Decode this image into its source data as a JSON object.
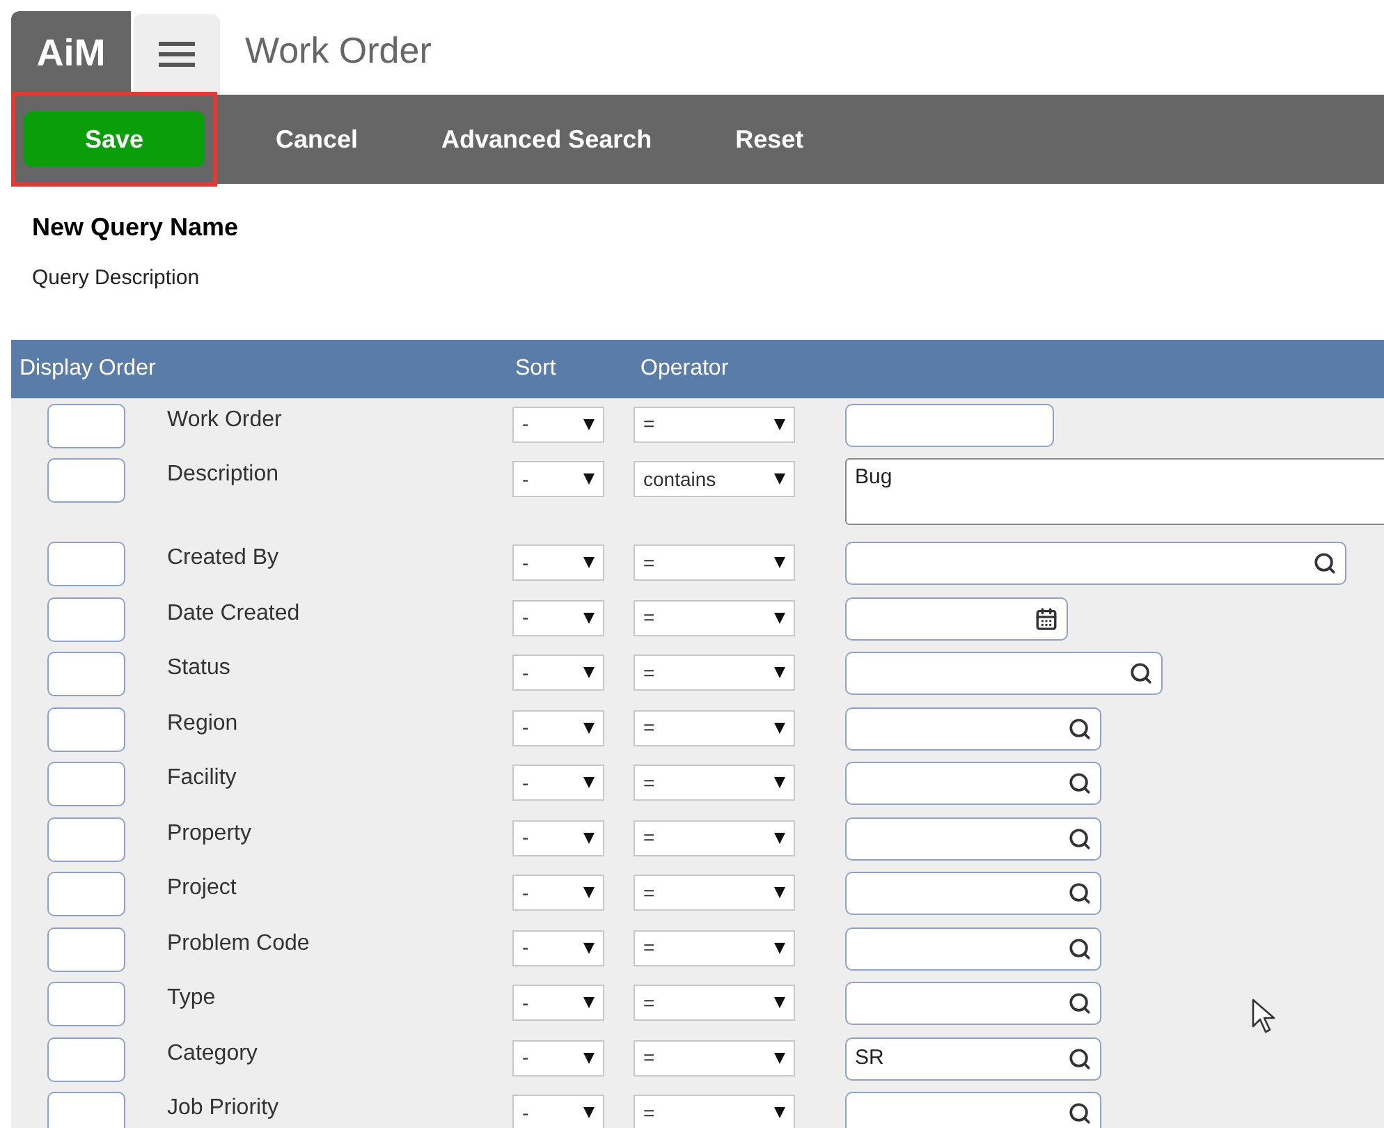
{
  "app": {
    "logo": "AiM",
    "title": "Work Order"
  },
  "toolbar": [
    {
      "label": "Save",
      "kind": "primary",
      "highlighted": true
    },
    {
      "label": "Cancel",
      "kind": "plain",
      "highlighted": false
    },
    {
      "label": "Advanced Search",
      "kind": "plain",
      "highlighted": false
    },
    {
      "label": "Reset",
      "kind": "plain",
      "highlighted": false
    }
  ],
  "query": {
    "name": "New Query Name",
    "description": "Query Description"
  },
  "table": {
    "columns": [
      "Display Order",
      "Sort",
      "Operator"
    ],
    "rows": [
      {
        "label": "Work Order",
        "sort": "-",
        "operator": "=",
        "kind": "text"
      },
      {
        "label": "Description",
        "sort": "-",
        "operator": "contains",
        "kind": "textarea",
        "value": "Bug"
      },
      {
        "label": "Created By",
        "sort": "-",
        "operator": "=",
        "kind": "lookup_wide"
      },
      {
        "label": "Date Created",
        "sort": "-",
        "operator": "=",
        "kind": "date"
      },
      {
        "label": "Status",
        "sort": "-",
        "operator": "=",
        "kind": "lookup_medium"
      },
      {
        "label": "Region",
        "sort": "-",
        "operator": "=",
        "kind": "lookup"
      },
      {
        "label": "Facility",
        "sort": "-",
        "operator": "=",
        "kind": "lookup"
      },
      {
        "label": "Property",
        "sort": "-",
        "operator": "=",
        "kind": "lookup"
      },
      {
        "label": "Project",
        "sort": "-",
        "operator": "=",
        "kind": "lookup"
      },
      {
        "label": "Problem Code",
        "sort": "-",
        "operator": "=",
        "kind": "lookup"
      },
      {
        "label": "Type",
        "sort": "-",
        "operator": "=",
        "kind": "lookup"
      },
      {
        "label": "Category",
        "sort": "-",
        "operator": "=",
        "kind": "lookup",
        "value": "SR"
      },
      {
        "label": "Job Priority",
        "sort": "-",
        "operator": "=",
        "kind": "lookup"
      }
    ]
  }
}
